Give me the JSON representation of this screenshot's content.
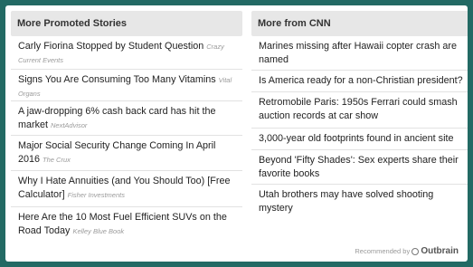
{
  "left": {
    "title": "More Promoted Stories",
    "items": [
      {
        "text": "Carly Fiorina Stopped by Student Question",
        "source": "Crazy Current Events"
      },
      {
        "text": "Signs You Are Consuming Too Many Vitamins",
        "source": "Vital Organs"
      },
      {
        "text": "A jaw-dropping 6% cash back card has hit the market",
        "source": "NextAdvisor"
      },
      {
        "text": "Major Social Security Change Coming In April 2016",
        "source": "The Crux"
      },
      {
        "text": "Why I Hate Annuities (and You Should Too) [Free Calculator]",
        "source": "Fisher Investments"
      },
      {
        "text": "Here Are the 10 Most Fuel Efficient SUVs on the Road Today",
        "source": "Kelley Blue Book"
      }
    ]
  },
  "right": {
    "title": "More from CNN",
    "items": [
      {
        "text": "Marines missing after Hawaii copter crash are named"
      },
      {
        "text": "Is America ready for a non-Christian president?"
      },
      {
        "text": "Retromobile Paris: 1950s Ferrari could smash auction records at car show"
      },
      {
        "text": "3,000-year old footprints found in ancient site"
      },
      {
        "text": "Beyond 'Fifty Shades': Sex experts share their favorite books"
      },
      {
        "text": "Utah brothers may have solved shooting mystery"
      }
    ]
  },
  "footer": {
    "recommended_label": "Recommended by",
    "brand": "Outbrain"
  }
}
